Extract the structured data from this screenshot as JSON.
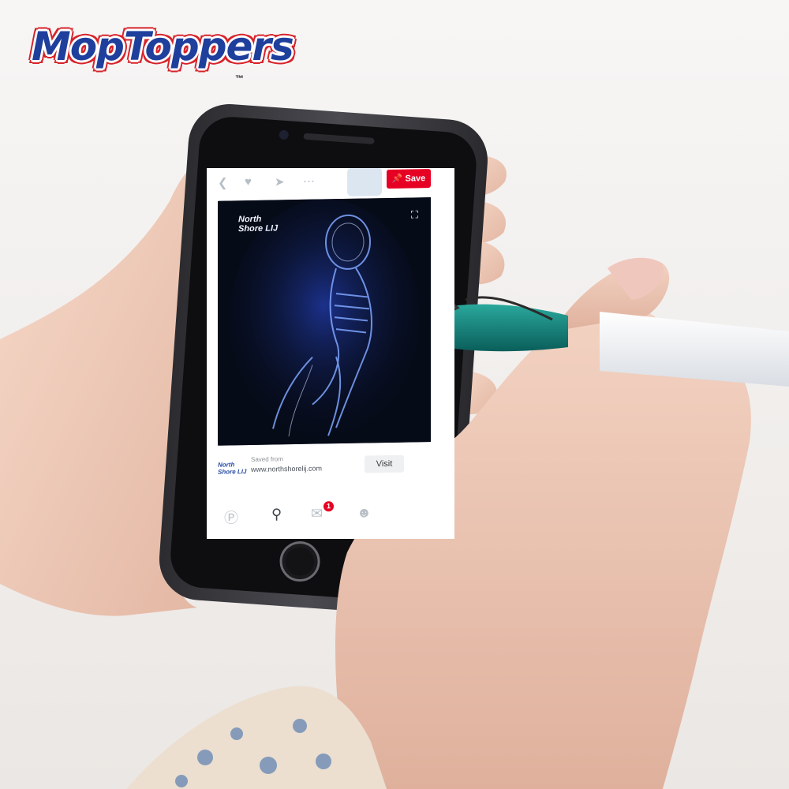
{
  "brand": {
    "name": "MopToppers",
    "trademark": "™"
  },
  "app": {
    "save_label": "Save",
    "icons": [
      "back-icon",
      "heart-icon",
      "send-icon",
      "more-icon"
    ],
    "pin": {
      "watermark_line1": "North",
      "watermark_line2": "Shore LIJ",
      "saved_from_label": "Saved from",
      "source_url": "www.northshorelij.com",
      "visit_label": "Visit"
    },
    "nav": {
      "notification_count": "1"
    }
  },
  "colors": {
    "brand_blue": "#1f3f9d",
    "brand_red": "#d6232a",
    "pinterest_red": "#e60023",
    "mop_hair": "#1fae9a",
    "pen_teal": "#0f7f7a"
  }
}
